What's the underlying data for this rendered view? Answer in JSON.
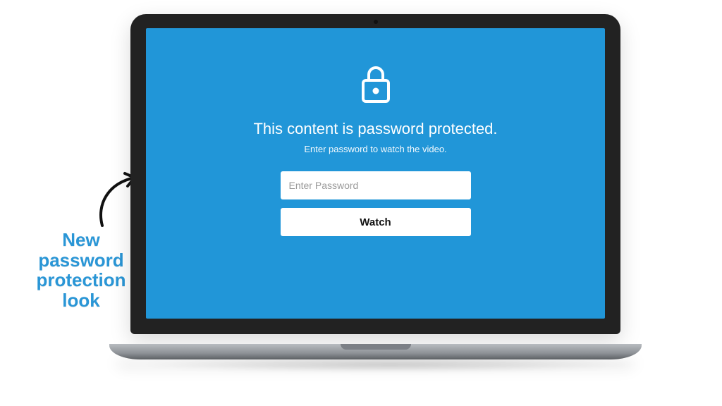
{
  "callout": {
    "line1": "New",
    "line2": "password",
    "line3": "protection",
    "line4": "look"
  },
  "screen": {
    "headline": "This content is password protected.",
    "subline": "Enter password to watch the video.",
    "password_placeholder": "Enter Password",
    "watch_label": "Watch"
  },
  "colors": {
    "screen_bg": "#2196d8",
    "callout_text": "#2a96d6"
  }
}
